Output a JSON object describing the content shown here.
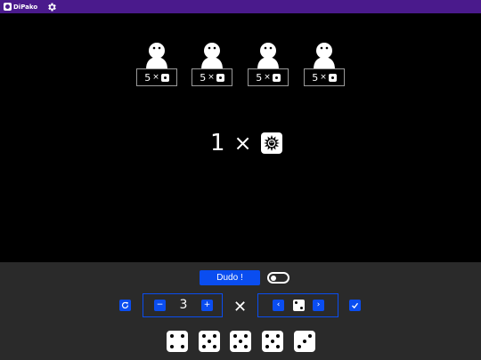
{
  "app": {
    "name": "DiPako"
  },
  "icons": {
    "logo": "logo-icon",
    "settings": "gear-icon",
    "reset": "refresh-icon",
    "confirm": "check-icon",
    "wild": "paco-icon"
  },
  "colors": {
    "topbar": "#4a1a8c",
    "accent": "#0a4df0",
    "panel": "#2a2a2a",
    "background": "#000000"
  },
  "players": [
    {
      "quantity": "5",
      "times": "×",
      "face": 1
    },
    {
      "quantity": "5",
      "times": "×",
      "face": 1
    },
    {
      "quantity": "5",
      "times": "×",
      "face": 1
    },
    {
      "quantity": "5",
      "times": "×",
      "face": 1
    }
  ],
  "current_bid": {
    "quantity": "1",
    "times": "×",
    "face": "paco"
  },
  "controls": {
    "dudo_label": "Dudo !",
    "toggle_on": false,
    "minus_label": "−",
    "plus_label": "+",
    "quantity_value": "3",
    "times": "✕",
    "prev_label": "‹",
    "next_label": "›",
    "selected_face": 2
  },
  "hand": [
    4,
    5,
    5,
    5,
    3
  ]
}
